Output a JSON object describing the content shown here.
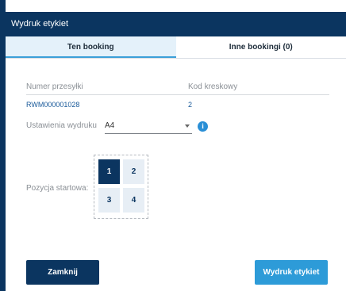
{
  "dialog": {
    "title": "Wydruk etykiet"
  },
  "tabs": [
    {
      "label": "Ten booking",
      "active": true
    },
    {
      "label": "Inne bookingi (0)",
      "active": false
    }
  ],
  "table": {
    "headers": [
      "Numer przesyłki",
      "Kod kreskowy"
    ],
    "rows": [
      [
        "RWM000001028",
        "2"
      ]
    ]
  },
  "print_settings": {
    "label": "Ustawienia wydruku",
    "value": "A4",
    "info_icon": "info-icon"
  },
  "start_position": {
    "label": "Pozycja startowa:",
    "cells": [
      "1",
      "2",
      "3",
      "4"
    ],
    "selected": "1"
  },
  "buttons": {
    "close": "Zamknij",
    "print": "Wydruk etykiet"
  },
  "colors": {
    "header": "#0b3560",
    "accent": "#2d9bd8",
    "tab_active_bg": "#e4f1fa"
  }
}
